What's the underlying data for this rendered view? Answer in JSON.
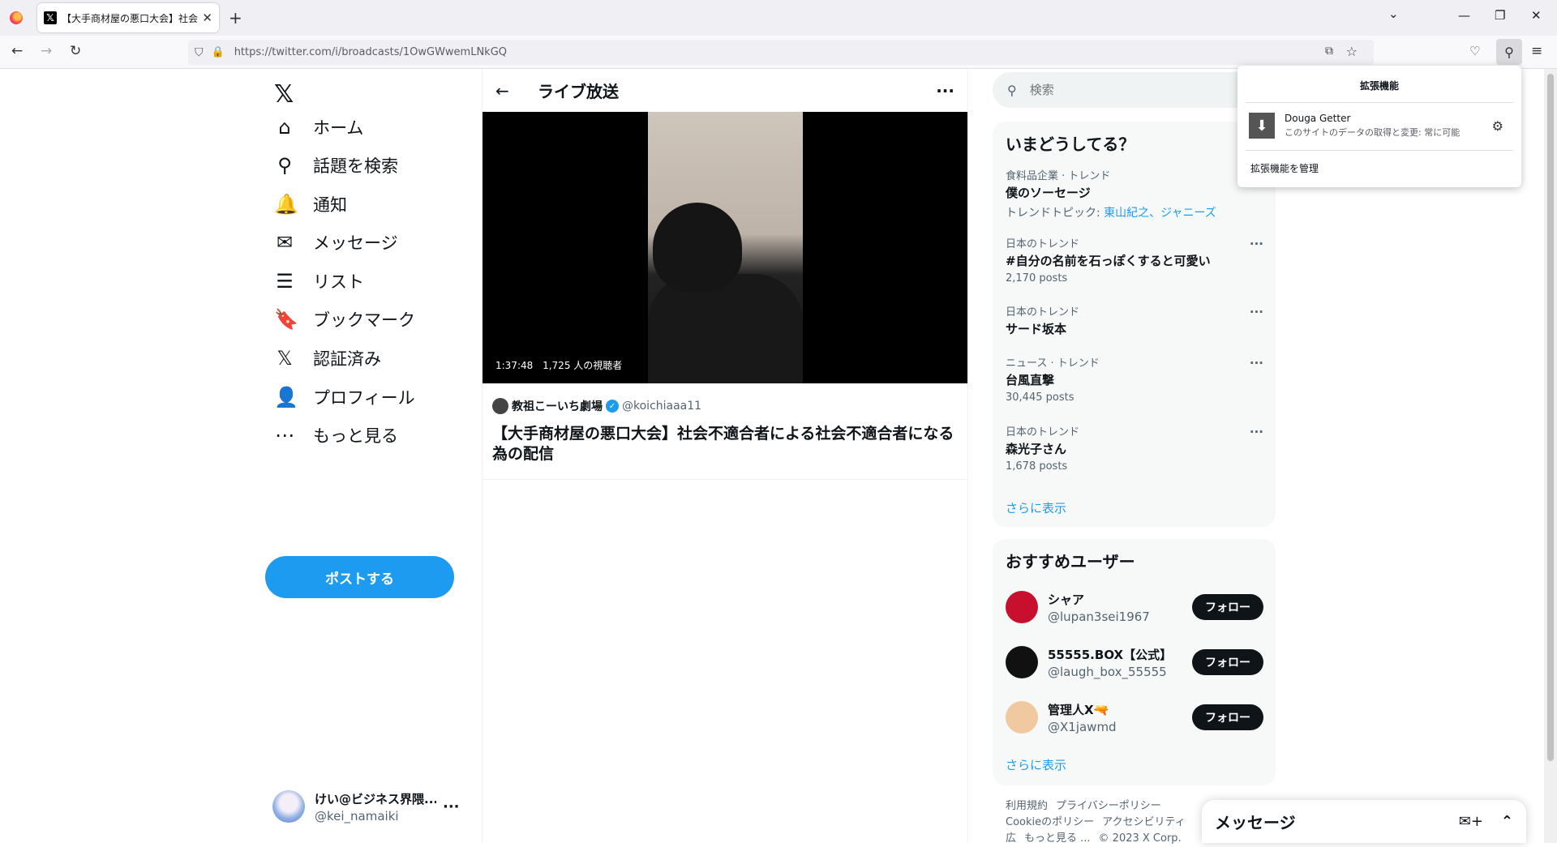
{
  "browser": {
    "tab_title": "【大手商材屋の悪口大会】社会不適合者による社会不適合者になる為の配信",
    "url": "https://twitter.com/i/broadcasts/1OwGWwemLNkGQ",
    "icons": {
      "firefox_logo": "firefox-icon",
      "tab_close": "✕",
      "new_tab": "+",
      "tab_list": "⌄",
      "minimize": "—",
      "maximize": "❐",
      "close": "✕",
      "back": "←",
      "forward": "→",
      "reload": "↻",
      "shield": "⛉",
      "lock": "🔒",
      "pip": "⧉",
      "star": "☆",
      "pocket": "♡",
      "extensions": "⚲",
      "menu": "≡"
    }
  },
  "nav": {
    "logo": "𝕏",
    "items": [
      {
        "icon": "⌂",
        "label": "ホーム",
        "icon_name": "home-icon"
      },
      {
        "icon": "⚲",
        "label": "話題を検索",
        "icon_name": "search-icon"
      },
      {
        "icon": "🔔",
        "label": "通知",
        "icon_name": "bell-icon"
      },
      {
        "icon": "✉",
        "label": "メッセージ",
        "icon_name": "mail-icon"
      },
      {
        "icon": "☰",
        "label": "リスト",
        "icon_name": "list-icon"
      },
      {
        "icon": "🔖",
        "label": "ブックマーク",
        "icon_name": "bookmark-icon"
      },
      {
        "icon": "𝕏",
        "label": "認証済み",
        "icon_name": "x-verified-icon"
      },
      {
        "icon": "👤",
        "label": "プロフィール",
        "icon_name": "profile-icon"
      },
      {
        "icon": "⋯",
        "label": "もっと見る",
        "icon_name": "more-circle-icon"
      }
    ],
    "post_button": "ポストする",
    "account": {
      "name": "けい@ビジネス界隈...",
      "handle": "@kei_namaiki",
      "more": "···"
    }
  },
  "main": {
    "back": "←",
    "title": "ライブ放送",
    "more": "···",
    "video": {
      "time": "1:37:48",
      "viewers": "1,725 人の視聴者"
    },
    "broadcaster": {
      "name": "教祖こーいち劇場",
      "verified": "✓",
      "handle": "@koichiaaa11"
    },
    "broadcast_title": "【大手商材屋の悪口大会】社会不適合者による社会不適合者になる為の配信"
  },
  "sidebar": {
    "search_placeholder": "検索",
    "trends_title": "いまどうしてる？",
    "trends": [
      {
        "category": "食料品企業 · トレンド",
        "name": "僕のソーセージ",
        "topics_label": "トレンドトピック: ",
        "topics": "東山紀之、ジャニーズ"
      },
      {
        "category": "日本のトレンド",
        "name": "#自分の名前を石っぽくすると可愛い",
        "posts": "2,170 posts"
      },
      {
        "category": "日本のトレンド",
        "name": "サード坂本"
      },
      {
        "category": "ニュース · トレンド",
        "name": "台風直撃",
        "posts": "30,445 posts"
      },
      {
        "category": "日本のトレンド",
        "name": "森光子さん",
        "posts": "1,678 posts"
      }
    ],
    "trend_more": "···",
    "trends_show_more": "さらに表示",
    "users_title": "おすすめユーザー",
    "users": [
      {
        "name": "シャア",
        "handle": "@lupan3sei1967",
        "follow": "フォロー",
        "avatar_color": "#c8102e"
      },
      {
        "name": "55555.BOX【公式】",
        "handle": "@laugh_box_55555",
        "follow": "フォロー",
        "avatar_color": "#111111"
      },
      {
        "name": "管理人X🔫",
        "handle": "@X1jawmd",
        "follow": "フォロー",
        "avatar_color": "#f1c9a0"
      }
    ],
    "users_show_more": "さらに表示",
    "footer": [
      "利用規約",
      "プライバシーポリシー",
      "Cookieのポリシー",
      "アクセシビリティ",
      "広",
      "もっと見る ...",
      "© 2023 X Corp."
    ]
  },
  "messages_drawer": {
    "title": "メッセージ",
    "new_icon": "✉+",
    "expand_icon": "⌃"
  },
  "extensions_popup": {
    "title": "拡張機能",
    "item_name": "Douga Getter",
    "item_desc": "このサイトのデータの取得と変更: 常に可能",
    "item_icon": "⬇",
    "gear": "⚙",
    "manage": "拡張機能を管理"
  },
  "colors": {
    "accent": "#1d9bf0",
    "text": "#0f1419",
    "muted": "#536471",
    "panel_bg": "#f7f9f9"
  }
}
